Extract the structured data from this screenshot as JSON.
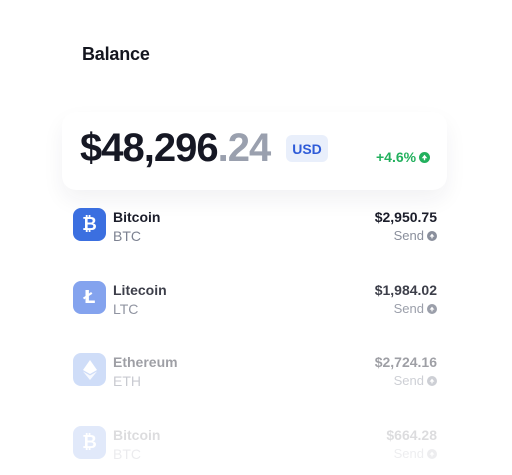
{
  "header": {
    "title": "Balance"
  },
  "balance": {
    "integer": "$48,296",
    "decimal": ".24",
    "currency": "USD",
    "change": "+4.6%",
    "change_color": "#22b05d",
    "change_icon": "arrow-up-circle-icon"
  },
  "assets": [
    {
      "name": "Bitcoin",
      "symbol": "BTC",
      "value": "$2,950.75",
      "action": "Send",
      "icon": "bitcoin-icon",
      "color": "#3b6fe0"
    },
    {
      "name": "Litecoin",
      "symbol": "LTC",
      "value": "$1,984.02",
      "action": "Send",
      "icon": "litecoin-icon",
      "color": "#6f93ec"
    },
    {
      "name": "Ethereum",
      "symbol": "ETH",
      "value": "$2,724.16",
      "action": "Send",
      "icon": "ethereum-icon",
      "color": "#8fb0f0"
    },
    {
      "name": "Bitcoin",
      "symbol": "BTC",
      "value": "$664.28",
      "action": "Send",
      "icon": "bitcoin-icon",
      "color": "#3b6fe0"
    }
  ]
}
